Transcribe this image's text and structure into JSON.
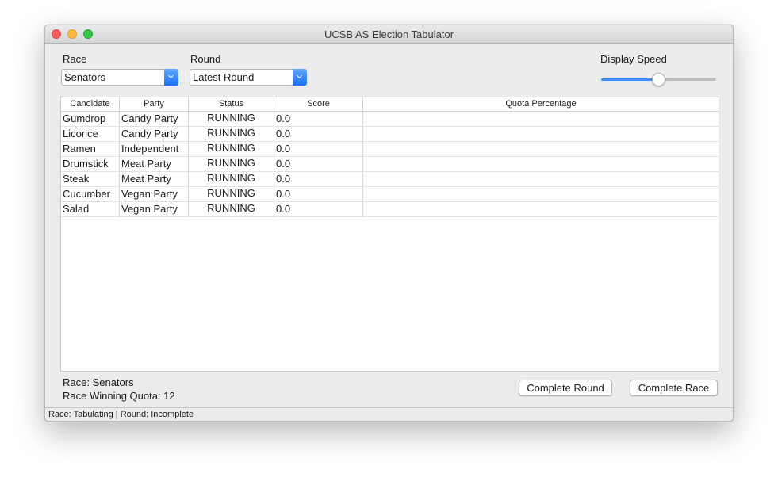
{
  "window": {
    "title": "UCSB AS Election Tabulator"
  },
  "controls": {
    "race_label": "Race",
    "race_value": "Senators",
    "round_label": "Round",
    "round_value": "Latest Round",
    "speed_label": "Display Speed",
    "speed_level": 0.5
  },
  "table": {
    "columns": [
      "Candidate",
      "Party",
      "Status",
      "Score",
      "Quota Percentage"
    ],
    "rows": [
      {
        "candidate": "Gumdrop",
        "party": "Candy Party",
        "status": "RUNNING",
        "score": "0.0",
        "quota": ""
      },
      {
        "candidate": "Licorice",
        "party": "Candy Party",
        "status": "RUNNING",
        "score": "0.0",
        "quota": ""
      },
      {
        "candidate": "Ramen",
        "party": "Independent",
        "status": "RUNNING",
        "score": "0.0",
        "quota": ""
      },
      {
        "candidate": "Drumstick",
        "party": "Meat Party",
        "status": "RUNNING",
        "score": "0.0",
        "quota": ""
      },
      {
        "candidate": "Steak",
        "party": "Meat Party",
        "status": "RUNNING",
        "score": "0.0",
        "quota": ""
      },
      {
        "candidate": "Cucumber",
        "party": "Vegan Party",
        "status": "RUNNING",
        "score": "0.0",
        "quota": ""
      },
      {
        "candidate": "Salad",
        "party": "Vegan Party",
        "status": "RUNNING",
        "score": "0.0",
        "quota": ""
      }
    ]
  },
  "summary": {
    "race_text": "Race: Senators",
    "quota_text": "Race Winning Quota: 12"
  },
  "buttons": {
    "complete_round": "Complete Round",
    "complete_race": "Complete Race"
  },
  "statusbar": {
    "text": "Race: Tabulating | Round: Incomplete"
  }
}
